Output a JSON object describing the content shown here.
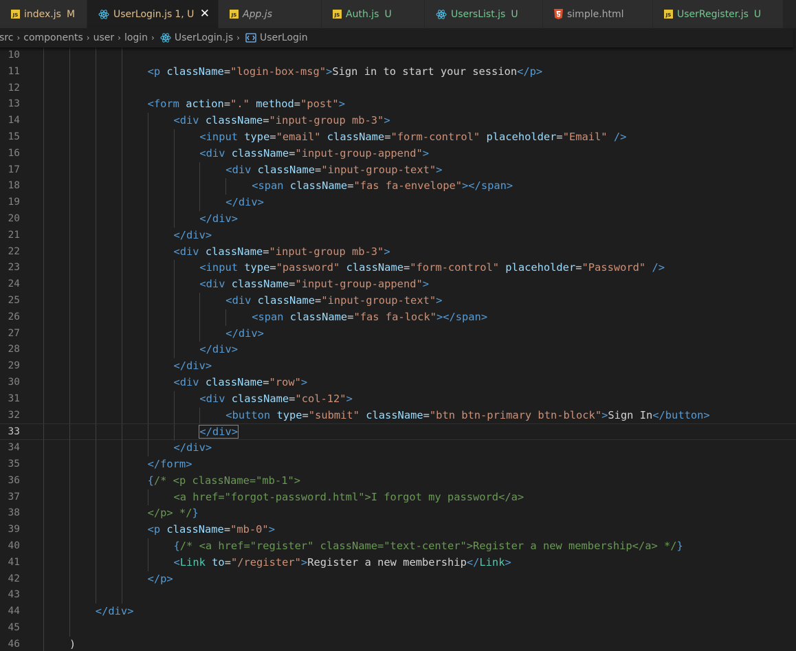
{
  "colors": {
    "editor_bg": "#1e1e1e",
    "tab_bar_bg": "#252526",
    "tab_inactive_bg": "#2d2d2d",
    "tag": "#569cd6",
    "attribute": "#9cdcfe",
    "string": "#ce9178",
    "comment": "#6a9955",
    "component": "#4ec9b0",
    "bracket": "#808080",
    "text": "#d4d4d4",
    "modified": "#e2c08d",
    "untracked": "#73c991",
    "error_name": "#e2c08d",
    "muted": "#a9a9a9"
  },
  "tabs": [
    {
      "label": "index.js",
      "status": "M",
      "icon": "js-file-icon",
      "label_color": "#e2c08d",
      "status_color": "#e2c08d",
      "italic": false,
      "active": false
    },
    {
      "label": "UserLogin.js",
      "status": "1, U",
      "icon": "react-file-icon",
      "label_color": "#e2c08d",
      "status_color": "#e2c08d",
      "italic": false,
      "active": true
    },
    {
      "label": "App.js",
      "status": "",
      "icon": "js-file-icon",
      "label_color": "#a9a9a9",
      "status_color": "#a9a9a9",
      "italic": true,
      "active": false
    },
    {
      "label": "Auth.js",
      "status": "U",
      "icon": "js-file-icon",
      "label_color": "#73c991",
      "status_color": "#73c991",
      "italic": false,
      "active": false
    },
    {
      "label": "UsersList.js",
      "status": "U",
      "icon": "react-file-icon",
      "label_color": "#73c991",
      "status_color": "#73c991",
      "italic": false,
      "active": false
    },
    {
      "label": "simple.html",
      "status": "",
      "icon": "html-file-icon",
      "label_color": "#a9a9a9",
      "status_color": "#a9a9a9",
      "italic": false,
      "active": false
    },
    {
      "label": "UserRegister.js",
      "status": "U",
      "icon": "js-file-icon",
      "label_color": "#73c991",
      "status_color": "#73c991",
      "italic": false,
      "active": false
    }
  ],
  "tab_close_glyph": "✕",
  "breadcrumb": {
    "parts": [
      "src",
      "components",
      "user",
      "login"
    ],
    "file": "UserLogin.js",
    "symbol": "UserLogin",
    "separator": "›"
  },
  "editor": {
    "current_line": 33,
    "lines": [
      {
        "n": 10,
        "indent": 0,
        "tokens": []
      },
      {
        "n": 11,
        "indent": 4,
        "tokens": [
          [
            "tag",
            "<p "
          ],
          [
            "attr",
            "className"
          ],
          [
            "txt",
            "="
          ],
          [
            "str",
            "\"login-box-msg\""
          ],
          [
            "tag",
            ">"
          ],
          [
            "txt",
            "Sign in to start your session"
          ],
          [
            "tag",
            "</p>"
          ]
        ]
      },
      {
        "n": 12,
        "indent": 0,
        "tokens": []
      },
      {
        "n": 13,
        "indent": 4,
        "tokens": [
          [
            "tag",
            "<form "
          ],
          [
            "attr",
            "action"
          ],
          [
            "txt",
            "="
          ],
          [
            "str",
            "\".\""
          ],
          [
            "txt",
            " "
          ],
          [
            "attr",
            "method"
          ],
          [
            "txt",
            "="
          ],
          [
            "str",
            "\"post\""
          ],
          [
            "tag",
            ">"
          ]
        ]
      },
      {
        "n": 14,
        "indent": 5,
        "tokens": [
          [
            "tag",
            "<div "
          ],
          [
            "attr",
            "className"
          ],
          [
            "txt",
            "="
          ],
          [
            "str",
            "\"input-group mb-3\""
          ],
          [
            "tag",
            ">"
          ]
        ]
      },
      {
        "n": 15,
        "indent": 6,
        "tokens": [
          [
            "tag",
            "<input "
          ],
          [
            "attr",
            "type"
          ],
          [
            "txt",
            "="
          ],
          [
            "str",
            "\"email\""
          ],
          [
            "txt",
            " "
          ],
          [
            "attr",
            "className"
          ],
          [
            "txt",
            "="
          ],
          [
            "str",
            "\"form-control\""
          ],
          [
            "txt",
            " "
          ],
          [
            "attr",
            "placeholder"
          ],
          [
            "txt",
            "="
          ],
          [
            "str",
            "\"Email\""
          ],
          [
            "txt",
            " "
          ],
          [
            "tag",
            "/>"
          ]
        ]
      },
      {
        "n": 16,
        "indent": 6,
        "tokens": [
          [
            "tag",
            "<div "
          ],
          [
            "attr",
            "className"
          ],
          [
            "txt",
            "="
          ],
          [
            "str",
            "\"input-group-append\""
          ],
          [
            "tag",
            ">"
          ]
        ]
      },
      {
        "n": 17,
        "indent": 7,
        "tokens": [
          [
            "tag",
            "<div "
          ],
          [
            "attr",
            "className"
          ],
          [
            "txt",
            "="
          ],
          [
            "str",
            "\"input-group-text\""
          ],
          [
            "tag",
            ">"
          ]
        ]
      },
      {
        "n": 18,
        "indent": 8,
        "tokens": [
          [
            "tag",
            "<span "
          ],
          [
            "attr",
            "className"
          ],
          [
            "txt",
            "="
          ],
          [
            "str",
            "\"fas fa-envelope\""
          ],
          [
            "tag",
            "></span>"
          ]
        ]
      },
      {
        "n": 19,
        "indent": 7,
        "tokens": [
          [
            "tag",
            "</div>"
          ]
        ]
      },
      {
        "n": 20,
        "indent": 6,
        "tokens": [
          [
            "tag",
            "</div>"
          ]
        ]
      },
      {
        "n": 21,
        "indent": 5,
        "tokens": [
          [
            "tag",
            "</div>"
          ]
        ]
      },
      {
        "n": 22,
        "indent": 5,
        "tokens": [
          [
            "tag",
            "<div "
          ],
          [
            "attr",
            "className"
          ],
          [
            "txt",
            "="
          ],
          [
            "str",
            "\"input-group mb-3\""
          ],
          [
            "tag",
            ">"
          ]
        ]
      },
      {
        "n": 23,
        "indent": 6,
        "tokens": [
          [
            "tag",
            "<input "
          ],
          [
            "attr",
            "type"
          ],
          [
            "txt",
            "="
          ],
          [
            "str",
            "\"password\""
          ],
          [
            "txt",
            " "
          ],
          [
            "attr",
            "className"
          ],
          [
            "txt",
            "="
          ],
          [
            "str",
            "\"form-control\""
          ],
          [
            "txt",
            " "
          ],
          [
            "attr",
            "placeholder"
          ],
          [
            "txt",
            "="
          ],
          [
            "str",
            "\"Password\""
          ],
          [
            "txt",
            " "
          ],
          [
            "tag",
            "/>"
          ]
        ]
      },
      {
        "n": 24,
        "indent": 6,
        "tokens": [
          [
            "tag",
            "<div "
          ],
          [
            "attr",
            "className"
          ],
          [
            "txt",
            "="
          ],
          [
            "str",
            "\"input-group-append\""
          ],
          [
            "tag",
            ">"
          ]
        ]
      },
      {
        "n": 25,
        "indent": 7,
        "tokens": [
          [
            "tag",
            "<div "
          ],
          [
            "attr",
            "className"
          ],
          [
            "txt",
            "="
          ],
          [
            "str",
            "\"input-group-text\""
          ],
          [
            "tag",
            ">"
          ]
        ]
      },
      {
        "n": 26,
        "indent": 8,
        "tokens": [
          [
            "tag",
            "<span "
          ],
          [
            "attr",
            "className"
          ],
          [
            "txt",
            "="
          ],
          [
            "str",
            "\"fas fa-lock\""
          ],
          [
            "tag",
            "></span>"
          ]
        ]
      },
      {
        "n": 27,
        "indent": 7,
        "tokens": [
          [
            "tag",
            "</div>"
          ]
        ]
      },
      {
        "n": 28,
        "indent": 6,
        "tokens": [
          [
            "tag",
            "</div>"
          ]
        ]
      },
      {
        "n": 29,
        "indent": 5,
        "tokens": [
          [
            "tag",
            "</div>"
          ]
        ]
      },
      {
        "n": 30,
        "indent": 5,
        "tokens": [
          [
            "tag",
            "<div "
          ],
          [
            "attr",
            "className"
          ],
          [
            "txt",
            "="
          ],
          [
            "str",
            "\"row\""
          ],
          [
            "tag",
            ">"
          ]
        ]
      },
      {
        "n": 31,
        "indent": 6,
        "tokens": [
          [
            "tag",
            "<div "
          ],
          [
            "attr",
            "className"
          ],
          [
            "txt",
            "="
          ],
          [
            "str",
            "\"col-12\""
          ],
          [
            "tag",
            ">"
          ]
        ]
      },
      {
        "n": 32,
        "indent": 7,
        "tokens": [
          [
            "tag",
            "<button "
          ],
          [
            "attr",
            "type"
          ],
          [
            "txt",
            "="
          ],
          [
            "str",
            "\"submit\""
          ],
          [
            "txt",
            " "
          ],
          [
            "attr",
            "className"
          ],
          [
            "txt",
            "="
          ],
          [
            "str",
            "\"btn btn-primary btn-block\""
          ],
          [
            "tag",
            ">"
          ],
          [
            "txt",
            "Sign In"
          ],
          [
            "tag",
            "</button>"
          ]
        ]
      },
      {
        "n": 33,
        "indent": 6,
        "tokens": [
          [
            "taghl",
            "</div>"
          ]
        ]
      },
      {
        "n": 34,
        "indent": 5,
        "tokens": [
          [
            "tag",
            "</div>"
          ]
        ]
      },
      {
        "n": 35,
        "indent": 4,
        "tokens": [
          [
            "tag",
            "</form>"
          ]
        ]
      },
      {
        "n": 36,
        "indent": 4,
        "tokens": [
          [
            "jsx",
            "{"
          ],
          [
            "cmt",
            "/* <p className=\"mb-1\">"
          ]
        ]
      },
      {
        "n": 37,
        "indent": 5,
        "tokens": [
          [
            "cmt",
            "<a href=\"forgot-password.html\">I forgot my password</a>"
          ]
        ]
      },
      {
        "n": 38,
        "indent": 4,
        "tokens": [
          [
            "cmt",
            "</p> */"
          ],
          [
            "jsx",
            "}"
          ]
        ]
      },
      {
        "n": 39,
        "indent": 4,
        "tokens": [
          [
            "tag",
            "<p "
          ],
          [
            "attr",
            "className"
          ],
          [
            "txt",
            "="
          ],
          [
            "str",
            "\"mb-0\""
          ],
          [
            "tag",
            ">"
          ]
        ]
      },
      {
        "n": 40,
        "indent": 5,
        "tokens": [
          [
            "jsx",
            "{"
          ],
          [
            "cmt",
            "/* <a href=\"register\" className=\"text-center\">Register a new membership</a> */"
          ],
          [
            "jsx",
            "}"
          ]
        ]
      },
      {
        "n": 41,
        "indent": 5,
        "tokens": [
          [
            "tag",
            "<"
          ],
          [
            "comp",
            "Link"
          ],
          [
            "txt",
            " "
          ],
          [
            "attr",
            "to"
          ],
          [
            "txt",
            "="
          ],
          [
            "str",
            "\"/register\""
          ],
          [
            "tag",
            ">"
          ],
          [
            "txt",
            "Register a new membership"
          ],
          [
            "tag",
            "</"
          ],
          [
            "comp",
            "Link"
          ],
          [
            "tag",
            ">"
          ]
        ]
      },
      {
        "n": 42,
        "indent": 4,
        "tokens": [
          [
            "tag",
            "</p>"
          ]
        ]
      },
      {
        "n": 43,
        "indent": 0,
        "tokens": []
      },
      {
        "n": 44,
        "indent": 2,
        "tokens": [
          [
            "tag",
            "</div>"
          ]
        ]
      },
      {
        "n": 45,
        "indent": 0,
        "tokens": []
      },
      {
        "n": 46,
        "indent": 1,
        "tokens": [
          [
            "txt",
            ")"
          ]
        ]
      }
    ]
  }
}
